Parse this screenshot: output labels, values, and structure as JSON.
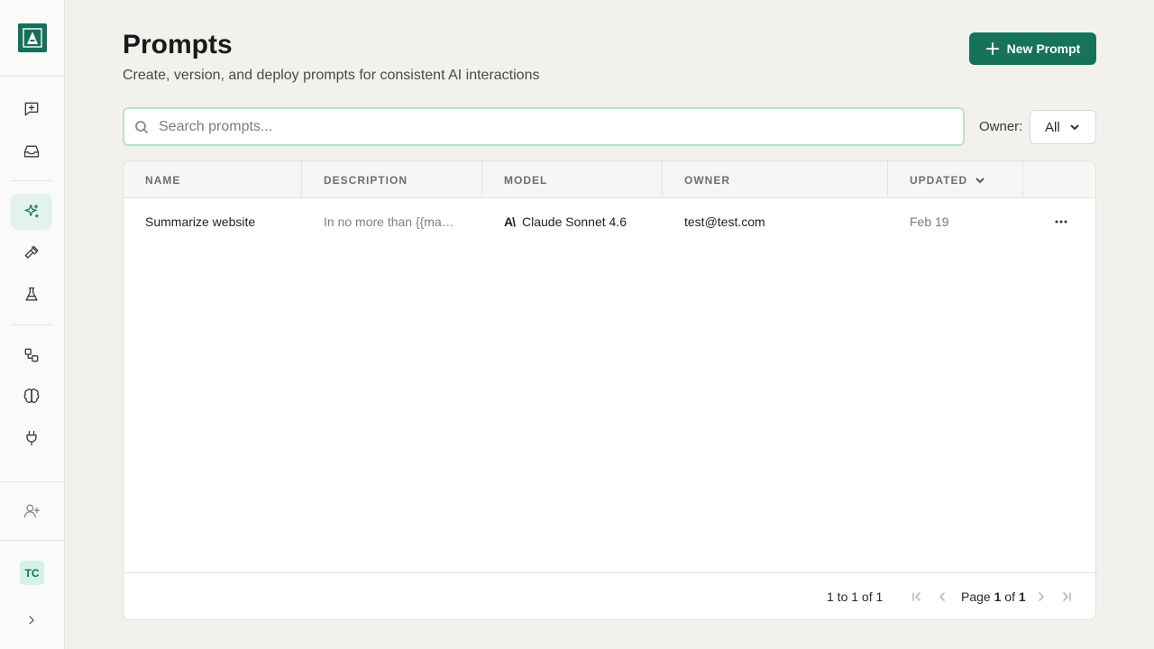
{
  "page": {
    "title": "Prompts",
    "subtitle": "Create, version, and deploy prompts for consistent AI interactions"
  },
  "actions": {
    "new_prompt_label": "New Prompt"
  },
  "search": {
    "placeholder": "Search prompts...",
    "value": ""
  },
  "filter": {
    "owner_label": "Owner:",
    "owner_value": "All"
  },
  "sidebar": {
    "avatar_initials": "TC",
    "items": [
      {
        "icon": "message-plus-icon",
        "active": false
      },
      {
        "icon": "inbox-icon",
        "active": false
      },
      {
        "icon": "sparkles-icon",
        "active": true
      },
      {
        "icon": "hammer-icon",
        "active": false
      },
      {
        "icon": "flask-icon",
        "active": false
      },
      {
        "icon": "workflow-icon",
        "active": false
      },
      {
        "icon": "brain-icon",
        "active": false
      },
      {
        "icon": "plug-icon",
        "active": false
      },
      {
        "icon": "user-plus-icon",
        "active": false
      }
    ]
  },
  "table": {
    "columns": [
      "NAME",
      "DESCRIPTION",
      "MODEL",
      "OWNER",
      "UPDATED"
    ],
    "rows": [
      {
        "name": "Summarize website",
        "description": "In no more than {{ma…",
        "model_brand": "A\\",
        "model": "Claude Sonnet 4.6",
        "owner": "test@test.com",
        "updated": "Feb 19"
      }
    ]
  },
  "pagination": {
    "range_text": "1 to 1 of 1",
    "page_text_prefix": "Page ",
    "current_page": "1",
    "page_text_mid": " of ",
    "total_pages": "1"
  },
  "colors": {
    "accent": "#167359",
    "background": "#f2f1ee",
    "active_nav_bg": "#e3f2ec"
  }
}
